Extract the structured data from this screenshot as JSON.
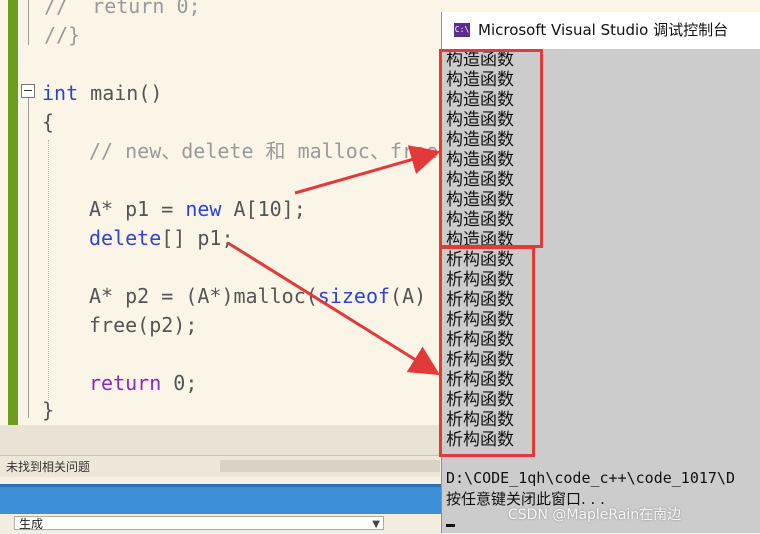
{
  "editor": {
    "lines": {
      "l1": "//  return 0;",
      "l2": "//}",
      "l3_kw": "int",
      "l3_rest": " main()",
      "l4": "{",
      "l5": "// new、delete 和 malloc、free",
      "l6_a": "A* p1 = ",
      "l6_new": "new",
      "l6_b": " A[10];",
      "l7_kw": "delete",
      "l7_b": "[] p1;",
      "l8_a": "A* p2 = (A*)malloc(",
      "l8_sizeof": "sizeof",
      "l8_b": "(A) *",
      "l9": "free(p2);",
      "l10_kw": "return",
      "l10_b": " 0;",
      "l11": "}"
    }
  },
  "status": {
    "issues_text": "未找到相关问题"
  },
  "output": {
    "source_selected": "生成"
  },
  "console": {
    "title": "Microsoft Visual Studio 调试控制台",
    "icon_text": "C:\\",
    "constructor_lines": [
      "构造函数",
      "构造函数",
      "构造函数",
      "构造函数",
      "构造函数",
      "构造函数",
      "构造函数",
      "构造函数",
      "构造函数",
      "构造函数"
    ],
    "destructor_lines": [
      "析构函数",
      "析构函数",
      "析构函数",
      "析构函数",
      "析构函数",
      "析构函数",
      "析构函数",
      "析构函数",
      "析构函数",
      "析构函数"
    ],
    "path_line": "D:\\CODE_1qh\\code_c++\\code_1017\\D",
    "press_line": "按任意键关闭此窗口. . ."
  },
  "watermark": "CSDN @MapleRain在南边",
  "colors": {
    "keyword": "#2c45d1",
    "purple_keyword": "#8a2ab8",
    "annotation_red": "#e23a3a",
    "change_bar_green": "#6e9c1f"
  }
}
